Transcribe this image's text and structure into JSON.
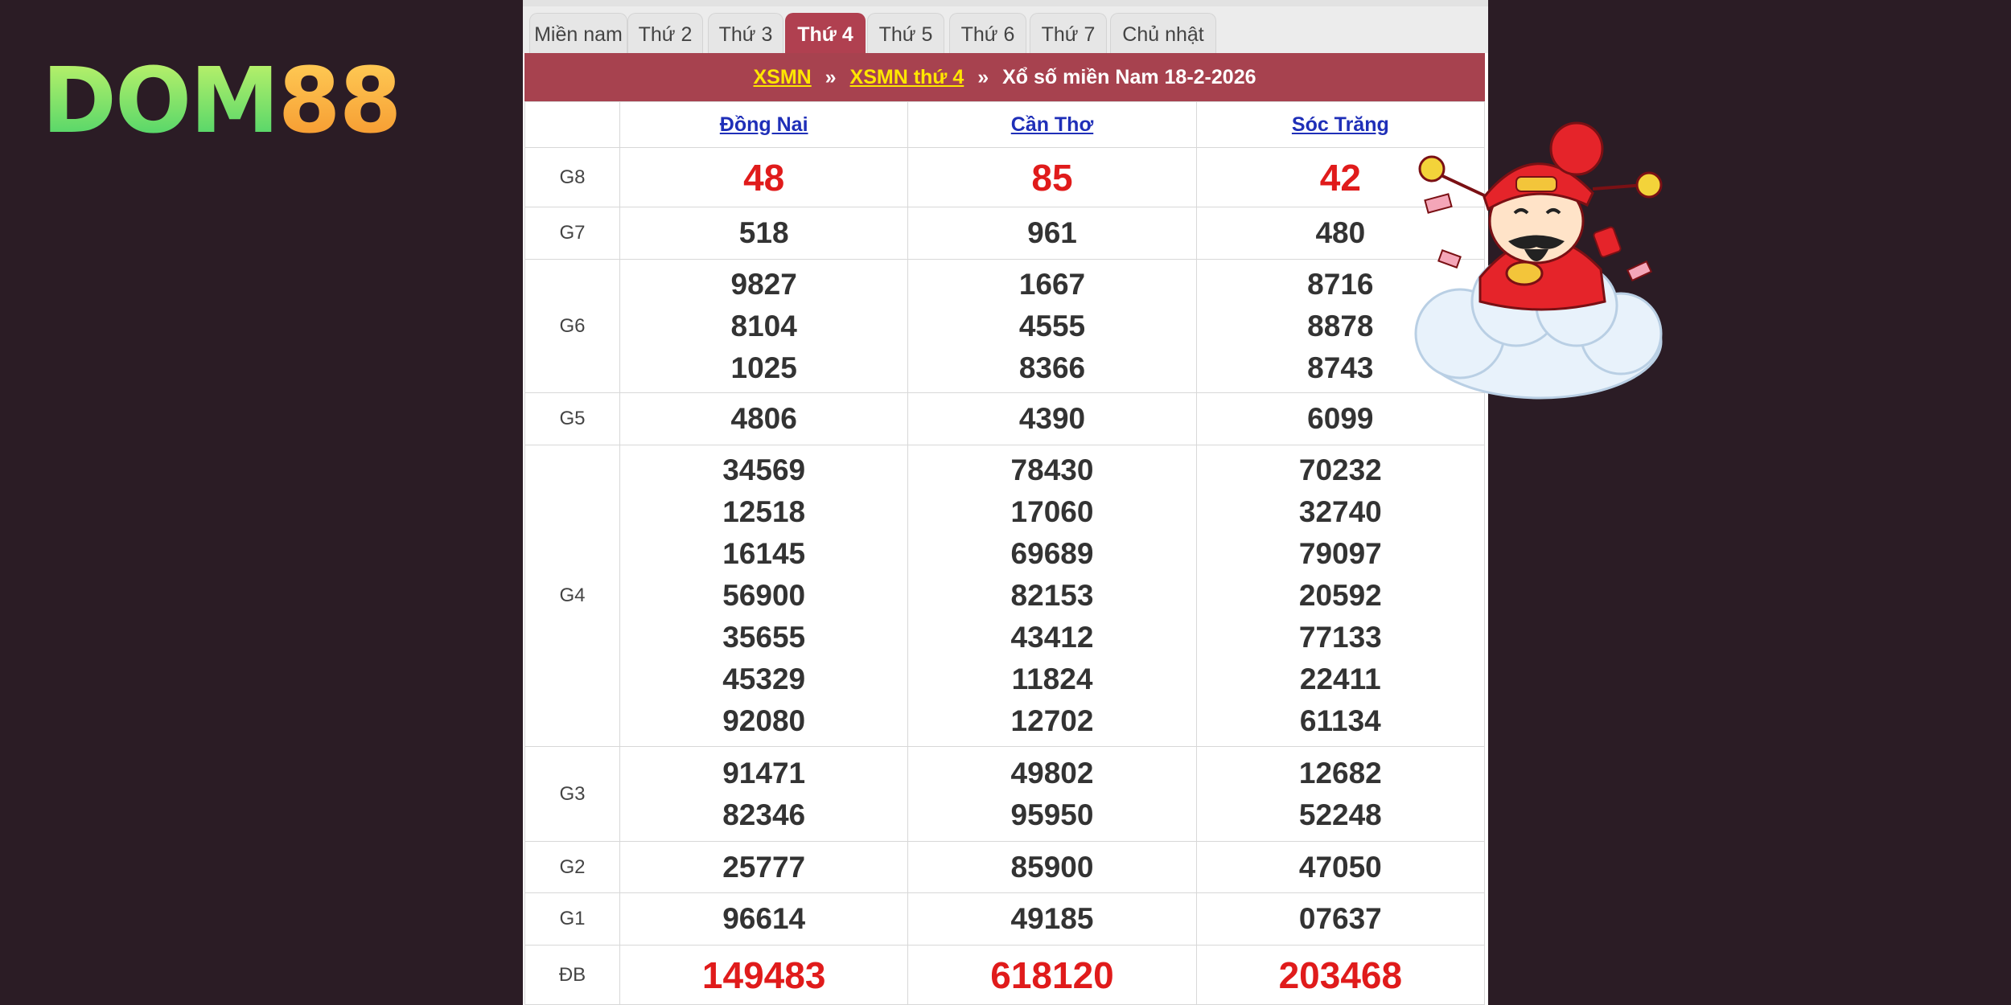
{
  "logo": {
    "dom": "DOM",
    "num": "88"
  },
  "tabs": [
    {
      "label": "Miền nam",
      "active": false
    },
    {
      "label": "Thứ 2",
      "active": false
    },
    {
      "label": "Thứ 3",
      "active": false
    },
    {
      "label": "Thứ 4",
      "active": true
    },
    {
      "label": "Thứ 5",
      "active": false
    },
    {
      "label": "Thứ 6",
      "active": false
    },
    {
      "label": "Thứ 7",
      "active": false
    },
    {
      "label": "Chủ nhật",
      "active": false
    }
  ],
  "title_bar": {
    "link1": "XSMN",
    "link2": "XSMN thứ 4",
    "separator": "»",
    "text": "Xổ số miền Nam 18-2-2026"
  },
  "provinces": [
    "Đồng Nai",
    "Cần Thơ",
    "Sóc Trăng"
  ],
  "rows": [
    {
      "label": "G8",
      "highlight": true,
      "values": [
        [
          "48"
        ],
        [
          "85"
        ],
        [
          "42"
        ]
      ]
    },
    {
      "label": "G7",
      "highlight": false,
      "values": [
        [
          "518"
        ],
        [
          "961"
        ],
        [
          "480"
        ]
      ]
    },
    {
      "label": "G6",
      "highlight": false,
      "values": [
        [
          "9827",
          "8104",
          "1025"
        ],
        [
          "1667",
          "4555",
          "8366"
        ],
        [
          "8716",
          "8878",
          "8743"
        ]
      ]
    },
    {
      "label": "G5",
      "highlight": false,
      "values": [
        [
          "4806"
        ],
        [
          "4390"
        ],
        [
          "6099"
        ]
      ]
    },
    {
      "label": "G4",
      "highlight": false,
      "values": [
        [
          "34569",
          "12518",
          "16145",
          "56900",
          "35655",
          "45329",
          "92080"
        ],
        [
          "78430",
          "17060",
          "69689",
          "82153",
          "43412",
          "11824",
          "12702"
        ],
        [
          "70232",
          "32740",
          "79097",
          "20592",
          "77133",
          "22411",
          "61134"
        ]
      ]
    },
    {
      "label": "G3",
      "highlight": false,
      "values": [
        [
          "91471",
          "82346"
        ],
        [
          "49802",
          "95950"
        ],
        [
          "12682",
          "52248"
        ]
      ]
    },
    {
      "label": "G2",
      "highlight": false,
      "values": [
        [
          "25777"
        ],
        [
          "85900"
        ],
        [
          "47050"
        ]
      ]
    },
    {
      "label": "G1",
      "highlight": false,
      "values": [
        [
          "96614"
        ],
        [
          "49185"
        ],
        [
          "07637"
        ]
      ]
    },
    {
      "label": "ĐB",
      "highlight": true,
      "values": [
        [
          "149483"
        ],
        [
          "618120"
        ],
        [
          "203468"
        ]
      ]
    }
  ],
  "colors": {
    "background": "#2b1c25",
    "title_bar": "#a7424f",
    "active_tab": "#b04050",
    "highlight_number": "#e01b1b",
    "province_link": "#1f2fb8",
    "crumb_link": "#ffe600"
  },
  "mascot": {
    "icon": "god-of-wealth-on-cloud-icon"
  }
}
